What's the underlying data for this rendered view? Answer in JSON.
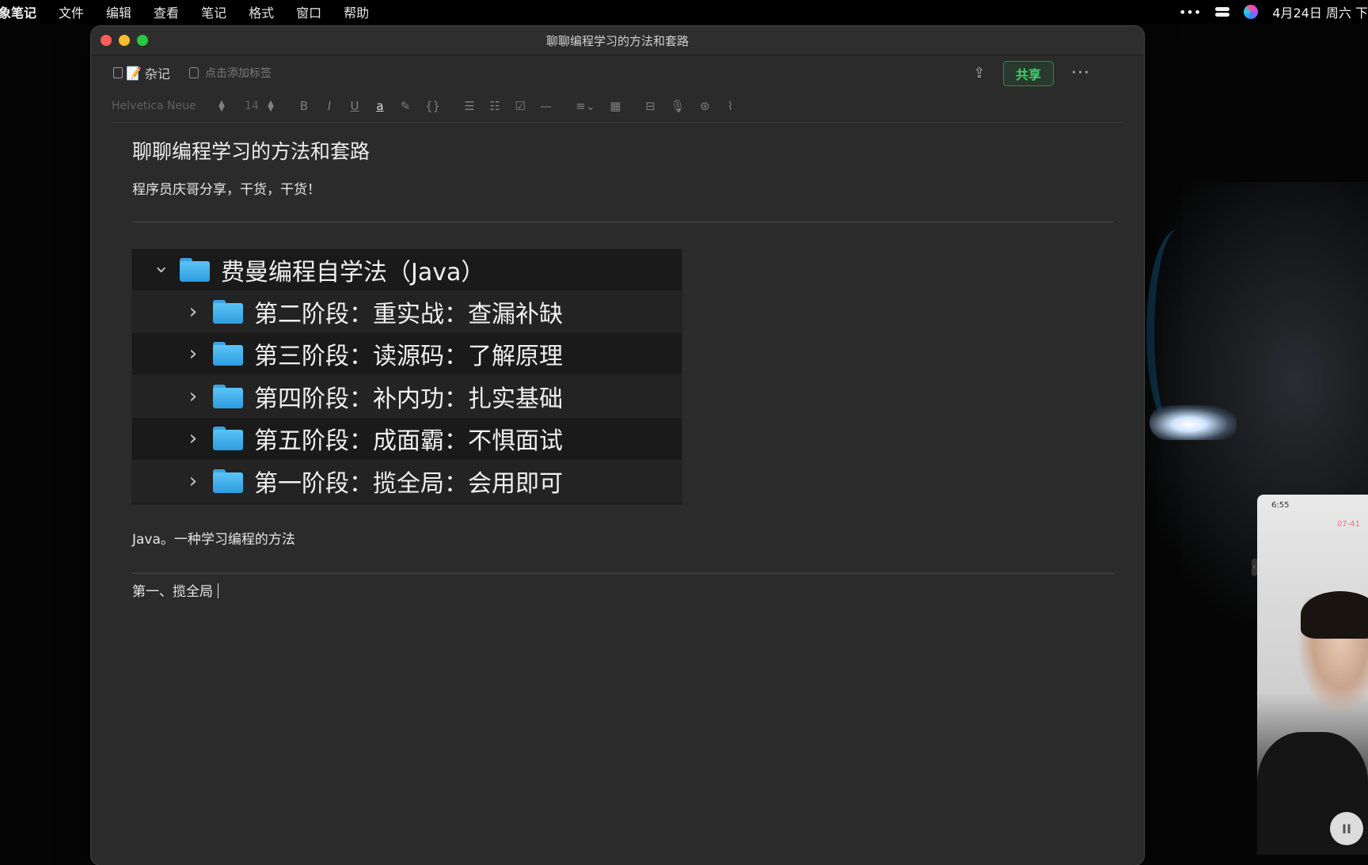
{
  "menubar": {
    "app_name": "象笔记",
    "items": [
      "文件",
      "编辑",
      "查看",
      "笔记",
      "格式",
      "窗口",
      "帮助"
    ],
    "more": "•••",
    "clock": "4月24日 周六 下"
  },
  "window": {
    "title": "聊聊编程学习的方法和套路"
  },
  "note_bar": {
    "notebook": "杂记",
    "tag_placeholder": "点击添加标签",
    "share_label": "共享",
    "more": "···"
  },
  "toolbar": {
    "font": "Helvetica Neue",
    "size": "14",
    "buttons": [
      "B",
      "I",
      "U",
      "a",
      "✎",
      "{}",
      "☰",
      "☷",
      "☑",
      "—",
      "≡⌄",
      "▦",
      "⊟",
      "🎙",
      "⊛",
      "⌇"
    ]
  },
  "note": {
    "title": "聊聊编程学习的方法和套路",
    "subtitle": "程序员庆哥分享，干货，干货！",
    "finder_root": "费曼编程自学法（Java）",
    "finder_items": [
      "第二阶段：重实战：查漏补缺",
      "第三阶段：读源码：了解原理",
      "第四阶段：补内功：扎实基础",
      "第五阶段：成面霸：不惧面试",
      "第一阶段：揽全局：会用即可"
    ],
    "paragraph": "Java。一种学习编程的方法",
    "section": "第一、揽全局"
  },
  "video_overlay": {
    "time": "6:55",
    "date": "07-41"
  }
}
